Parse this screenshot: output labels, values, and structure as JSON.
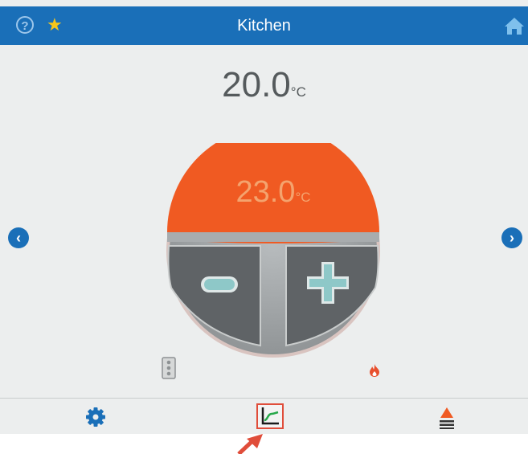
{
  "header": {
    "title": "Kitchen",
    "help_icon_text": "?",
    "favourite_icon_text": "★"
  },
  "current_temperature": {
    "value": "20.0",
    "unit": "°C"
  },
  "setpoint": {
    "value": "23.0",
    "unit": "°C"
  },
  "navigation": {
    "previous_glyph": "‹",
    "next_glyph": "›"
  },
  "icons": {
    "help": "help-icon",
    "favourite": "star-icon",
    "home": "home-icon",
    "previous": "chevron-left-icon",
    "next": "chevron-right-icon",
    "decrease": "minus-icon",
    "increase": "plus-icon",
    "remote": "remote-icon",
    "heating": "flame-icon",
    "settings": "gear-icon",
    "chart": "chart-icon",
    "alerts": "alert-list-icon",
    "pointer": "arrow-icon"
  },
  "colors": {
    "header": "#1a6fb8",
    "setpoint_dome": "#f05a22",
    "setpoint_text": "#f4a36e",
    "buttons": "#5f6366",
    "button_symbol": "#8ec8c8",
    "flame": "#e8502e",
    "highlight": "#e04d3a"
  }
}
